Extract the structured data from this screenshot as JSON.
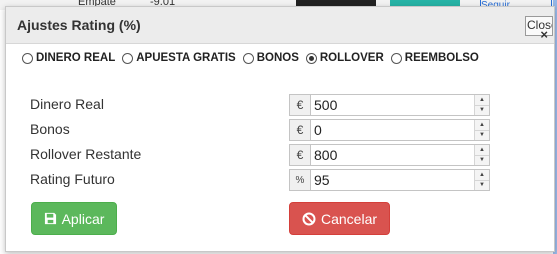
{
  "background": {
    "left_text": "Empate",
    "mid_text": "-9.01",
    "blue_text": "Seguir"
  },
  "modal": {
    "title": "Ajustes Rating (%)",
    "close_label": "Close",
    "close_glyph": "×"
  },
  "radios": [
    {
      "label": "DINERO REAL",
      "checked": false
    },
    {
      "label": "APUESTA GRATIS",
      "checked": false
    },
    {
      "label": "BONOS",
      "checked": false
    },
    {
      "label": "ROLLOVER",
      "checked": true
    },
    {
      "label": "REEMBOLSO",
      "checked": false
    }
  ],
  "fields": [
    {
      "label": "Dinero Real",
      "addon": "€",
      "value": "500"
    },
    {
      "label": "Bonos",
      "addon": "€",
      "value": "0"
    },
    {
      "label": "Rollover Restante",
      "addon": "€",
      "value": "800"
    },
    {
      "label": "Rating Futuro",
      "addon": "%",
      "value": "95"
    }
  ],
  "buttons": {
    "apply_label": "Aplicar",
    "apply_icon": "save-icon",
    "cancel_label": "Cancelar",
    "cancel_icon": "ban-icon"
  },
  "colors": {
    "apply": "#5cb85c",
    "cancel": "#d9534f"
  }
}
